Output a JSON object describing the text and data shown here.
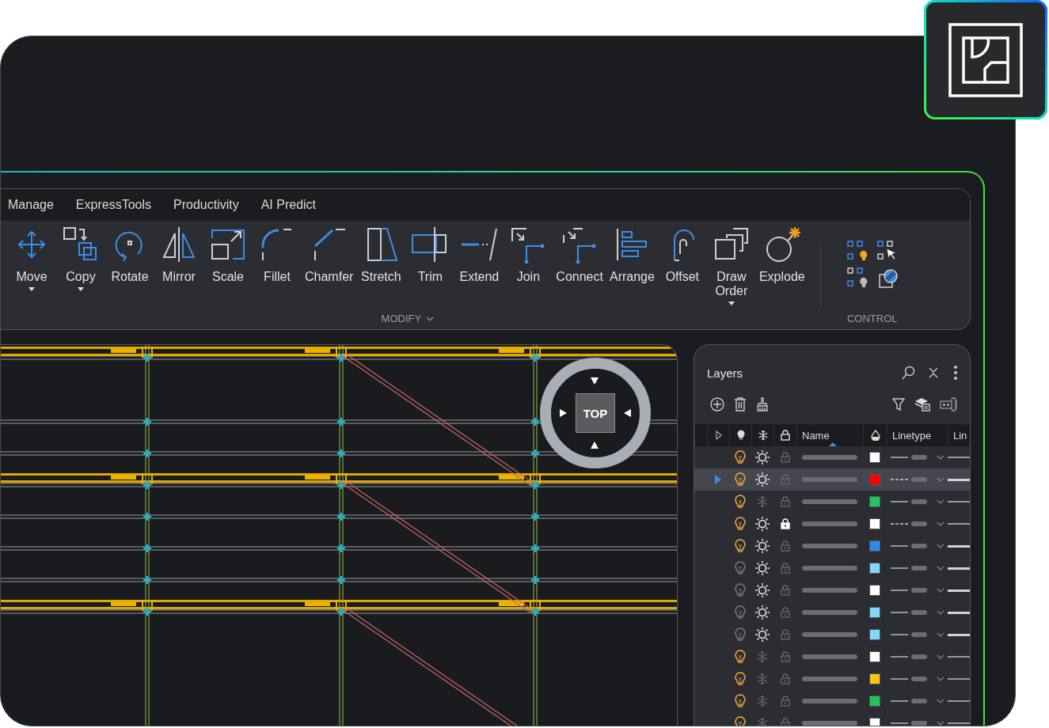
{
  "ribbon": {
    "tabs": [
      {
        "label": "Manage",
        "selected": false
      },
      {
        "label": "ExpressTools",
        "selected": false
      },
      {
        "label": "Productivity",
        "selected": false
      },
      {
        "label": "AI Predict",
        "selected": false
      }
    ],
    "tools": [
      {
        "label": "Move",
        "dropdown": true
      },
      {
        "label": "Copy",
        "dropdown": true
      },
      {
        "label": "Rotate",
        "dropdown": false
      },
      {
        "label": "Mirror",
        "dropdown": false
      },
      {
        "label": "Scale",
        "dropdown": false
      },
      {
        "label": "Fillet",
        "dropdown": false
      },
      {
        "label": "Chamfer",
        "dropdown": false
      },
      {
        "label": "Stretch",
        "dropdown": false
      },
      {
        "label": "Trim",
        "dropdown": false
      },
      {
        "label": "Extend",
        "dropdown": false
      },
      {
        "label": "Join",
        "dropdown": false
      },
      {
        "label": "Connect",
        "dropdown": false
      },
      {
        "label": "Arrange",
        "dropdown": false
      },
      {
        "label": "Offset",
        "dropdown": false
      },
      {
        "label": "Draw Order",
        "dropdown": true
      },
      {
        "label": "Explode",
        "dropdown": false
      }
    ],
    "groups": [
      {
        "label": "MODIFY",
        "expandable": true
      },
      {
        "label": "CONTROL",
        "expandable": false
      }
    ]
  },
  "viewport": {
    "nav_label": "TOP"
  },
  "layers": {
    "title": "Layers",
    "columns": [
      "Name",
      "Linetype",
      "Lin"
    ],
    "rows": [
      {
        "selected": false,
        "on": true,
        "frozen": false,
        "locked": false,
        "color": "#ffffff",
        "dashed": false,
        "wide_lineweight": false
      },
      {
        "selected": true,
        "on": true,
        "frozen": false,
        "locked": false,
        "color": "#ff0000",
        "dashed": true,
        "wide_lineweight": true
      },
      {
        "selected": false,
        "on": true,
        "frozen": true,
        "locked": false,
        "color": "#22c55e",
        "dashed": false,
        "wide_lineweight": false
      },
      {
        "selected": false,
        "on": true,
        "frozen": false,
        "locked": true,
        "color": "#ffffff",
        "dashed": true,
        "wide_lineweight": false
      },
      {
        "selected": false,
        "on": true,
        "frozen": false,
        "locked": false,
        "color": "#2a8cf0",
        "dashed": false,
        "wide_lineweight": true
      },
      {
        "selected": false,
        "on": false,
        "frozen": false,
        "locked": false,
        "color": "#7fd8ff",
        "dashed": false,
        "wide_lineweight": true
      },
      {
        "selected": false,
        "on": false,
        "frozen": false,
        "locked": false,
        "color": "#ffffff",
        "dashed": false,
        "wide_lineweight": true
      },
      {
        "selected": false,
        "on": false,
        "frozen": false,
        "locked": false,
        "color": "#7fd8ff",
        "dashed": false,
        "wide_lineweight": true
      },
      {
        "selected": false,
        "on": false,
        "frozen": false,
        "locked": false,
        "color": "#7fd8ff",
        "dashed": false,
        "wide_lineweight": true
      },
      {
        "selected": false,
        "on": true,
        "frozen": true,
        "locked": false,
        "color": "#ffffff",
        "dashed": false,
        "wide_lineweight": false
      },
      {
        "selected": false,
        "on": true,
        "frozen": true,
        "locked": false,
        "color": "#ffc20e",
        "dashed": false,
        "wide_lineweight": false
      },
      {
        "selected": false,
        "on": true,
        "frozen": true,
        "locked": false,
        "color": "#22c55e",
        "dashed": false,
        "wide_lineweight": false
      },
      {
        "selected": false,
        "on": true,
        "frozen": true,
        "locked": false,
        "color": "#ffffff",
        "dashed": false,
        "wide_lineweight": false
      }
    ]
  }
}
